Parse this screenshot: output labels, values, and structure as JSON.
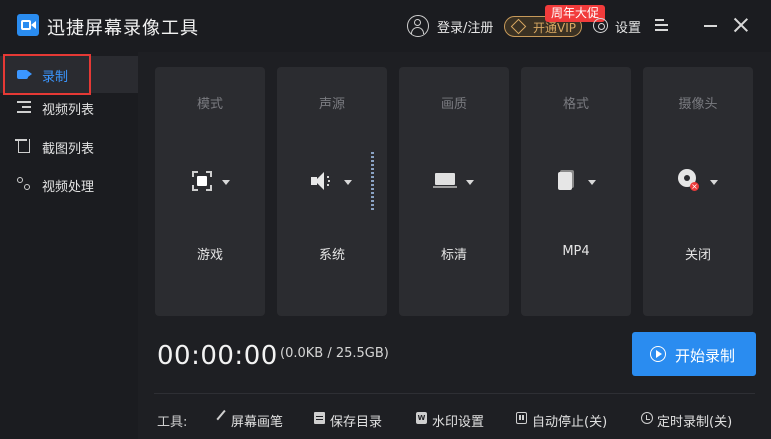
{
  "app": {
    "title": "迅捷屏幕录像工具"
  },
  "header": {
    "login_label": "登录/注册",
    "vip_label": "开通VIP",
    "promo_badge": "周年大促",
    "settings_label": "设置"
  },
  "sidebar": {
    "items": [
      {
        "label": "录制",
        "icon": "record-icon",
        "active": true
      },
      {
        "label": "视频列表",
        "icon": "video-list-icon"
      },
      {
        "label": "截图列表",
        "icon": "screenshot-list-icon"
      },
      {
        "label": "视频处理",
        "icon": "video-process-icon"
      }
    ]
  },
  "options": [
    {
      "title": "模式",
      "value": "游戏",
      "icon": "mode-icon"
    },
    {
      "title": "声源",
      "value": "系统",
      "icon": "speaker-icon"
    },
    {
      "title": "画质",
      "value": "标清",
      "icon": "quality-icon"
    },
    {
      "title": "格式",
      "value": "MP4",
      "icon": "format-icon"
    },
    {
      "title": "摄像头",
      "value": "关闭",
      "icon": "camera-icon"
    }
  ],
  "status": {
    "timer": "00:00:00",
    "size_info": "(0.0KB / 25.5GB)"
  },
  "start_button": {
    "label": "开始录制"
  },
  "tools": {
    "label": "工具:",
    "items": [
      {
        "label": "屏幕画笔",
        "icon": "pen-icon"
      },
      {
        "label": "保存目录",
        "icon": "folder-icon"
      },
      {
        "label": "水印设置",
        "icon": "watermark-icon"
      },
      {
        "label": "自动停止(关)",
        "icon": "auto-stop-icon"
      },
      {
        "label": "定时录制(关)",
        "icon": "timer-icon"
      }
    ]
  },
  "colors": {
    "accent": "#2a8cf0",
    "active_text": "#3b96ff",
    "vip_gold": "#d8a862",
    "promo_red": "#f23b3b",
    "highlight_outline": "#e53935"
  }
}
